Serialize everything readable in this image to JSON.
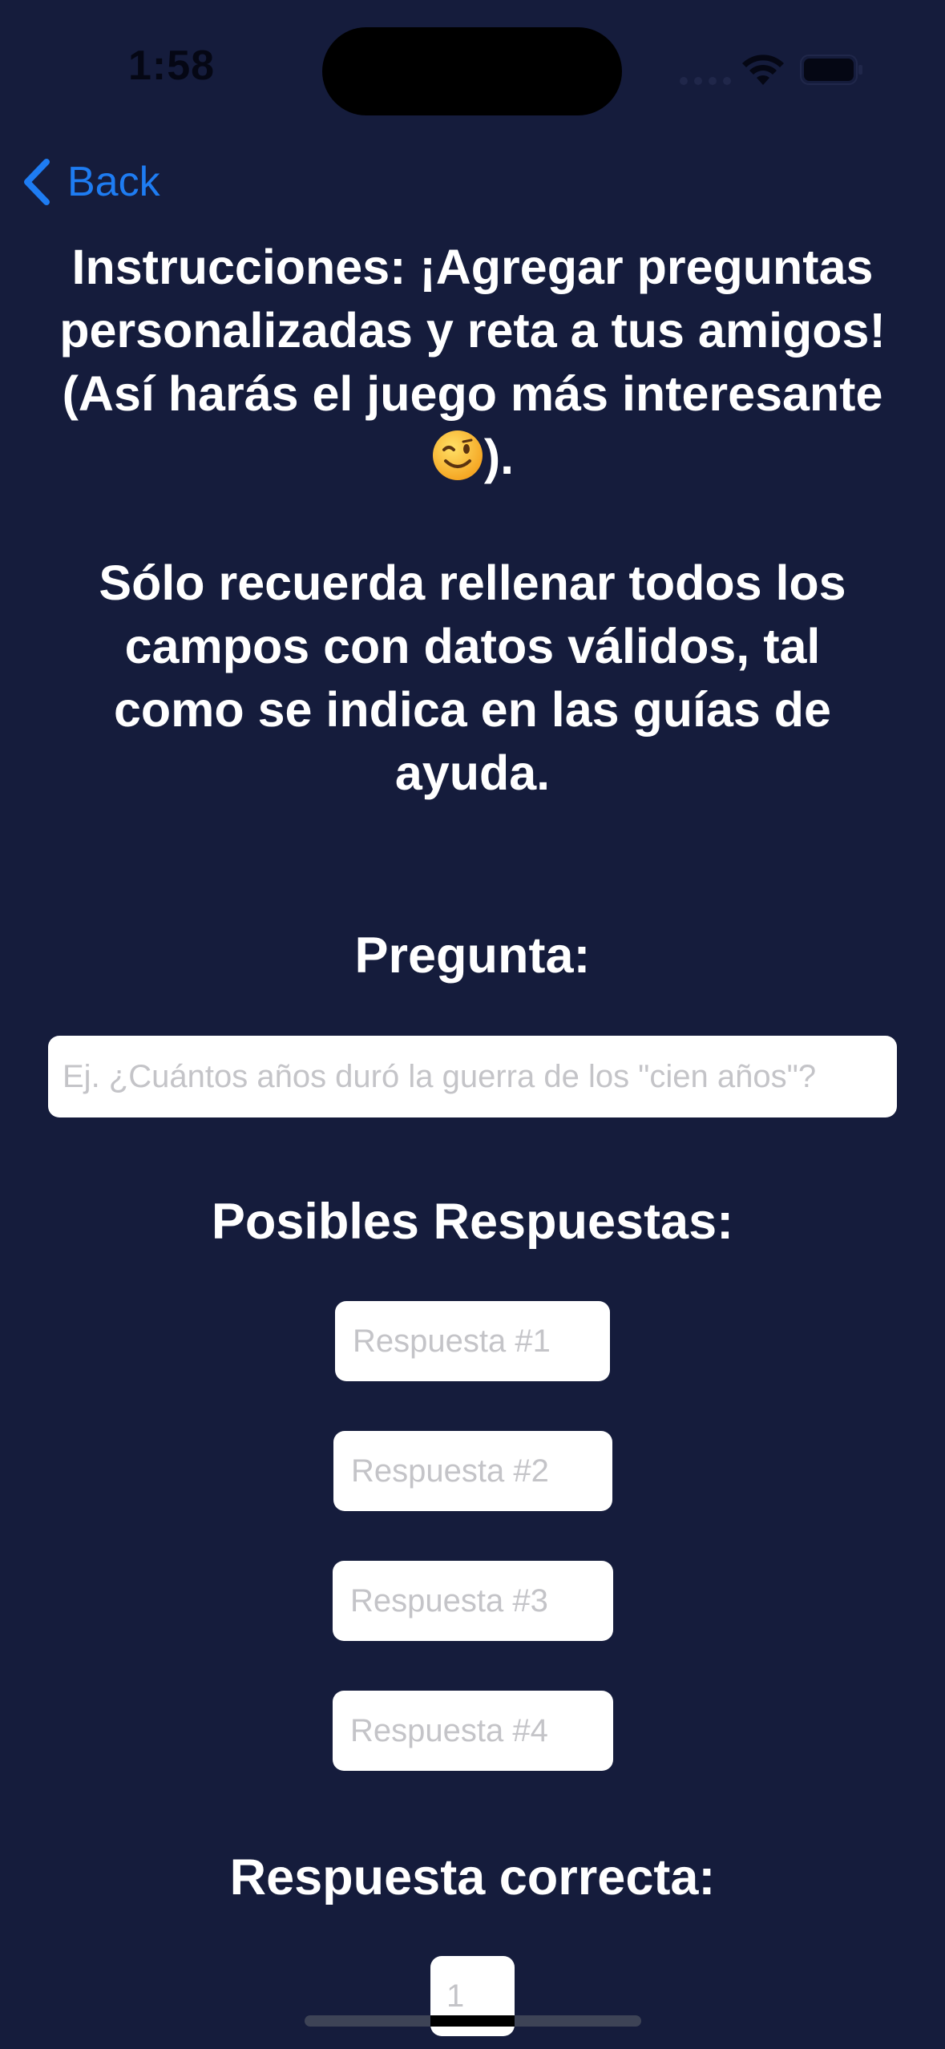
{
  "status_bar": {
    "time": "1:58"
  },
  "nav": {
    "back_label": "Back",
    "back_icon": "chevron-left-icon",
    "accent_color": "#1e7cf2"
  },
  "instructions": {
    "line_text": "Instrucciones: ¡Agregar preguntas personalizadas y reta a tus amigos! (Así harás el juego más interesante",
    "emoji": "winking-face-icon",
    "line_end": ").",
    "reminder": "Sólo recuerda rellenar todos los campos con datos válidos, tal como se indica en las guías de ayuda."
  },
  "question": {
    "title": "Pregunta:",
    "placeholder": "Ej. ¿Cuántos años duró la guerra de los \"cien años\"?",
    "value": ""
  },
  "answers": {
    "title": "Posibles Respuestas:",
    "fields": [
      {
        "placeholder": "Respuesta #1",
        "value": ""
      },
      {
        "placeholder": "Respuesta #2",
        "value": ""
      },
      {
        "placeholder": "Respuesta #3",
        "value": ""
      },
      {
        "placeholder": "Respuesta #4",
        "value": ""
      }
    ]
  },
  "correct_answer": {
    "title": "Respuesta correcta:",
    "placeholder": "1",
    "value": ""
  },
  "colors": {
    "background": "#151c3c",
    "text": "#ffffff",
    "field_background": "#ffffff",
    "placeholder": "#c4c4c8"
  }
}
